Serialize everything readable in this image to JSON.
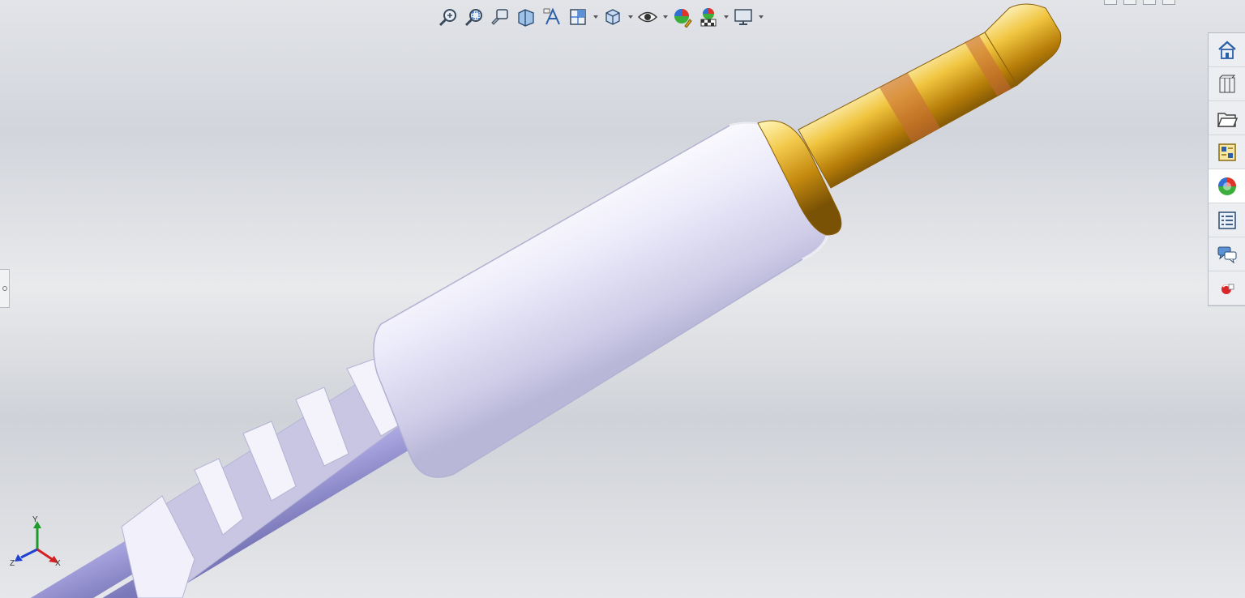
{
  "heads_up_toolbar": {
    "tools": [
      {
        "name": "zoom-to-fit-icon"
      },
      {
        "name": "zoom-to-area-icon"
      },
      {
        "name": "previous-view-icon"
      },
      {
        "name": "section-view-icon"
      },
      {
        "name": "dynamic-annotation-icon"
      },
      {
        "name": "view-orientation-icon",
        "dropdown": true
      },
      {
        "name": "display-style-icon",
        "dropdown": true
      },
      {
        "name": "hide-show-items-icon",
        "dropdown": true
      },
      {
        "name": "edit-appearance-icon"
      },
      {
        "name": "apply-scene-icon",
        "dropdown": true
      },
      {
        "name": "view-settings-icon",
        "dropdown": true
      }
    ]
  },
  "task_pane": {
    "tabs": [
      {
        "name": "solidworks-resources-icon"
      },
      {
        "name": "design-library-icon"
      },
      {
        "name": "file-explorer-icon"
      },
      {
        "name": "view-palette-icon"
      },
      {
        "name": "appearances-scenes-icon",
        "active": true
      },
      {
        "name": "custom-properties-icon"
      },
      {
        "name": "forum-icon"
      },
      {
        "name": "solidworks-add-in-icon"
      }
    ]
  },
  "triad": {
    "axis_y": "Y",
    "axis_z": "Z",
    "axis_x": "X",
    "colors": {
      "x": "#d42020",
      "y": "#1f9a2c",
      "z": "#2040d0"
    }
  },
  "model": {
    "colors": {
      "housing": "#e6e4f6",
      "cable": "#a8a6e0",
      "gold": "#d9a21a",
      "copper_band": "#c8693a"
    }
  }
}
